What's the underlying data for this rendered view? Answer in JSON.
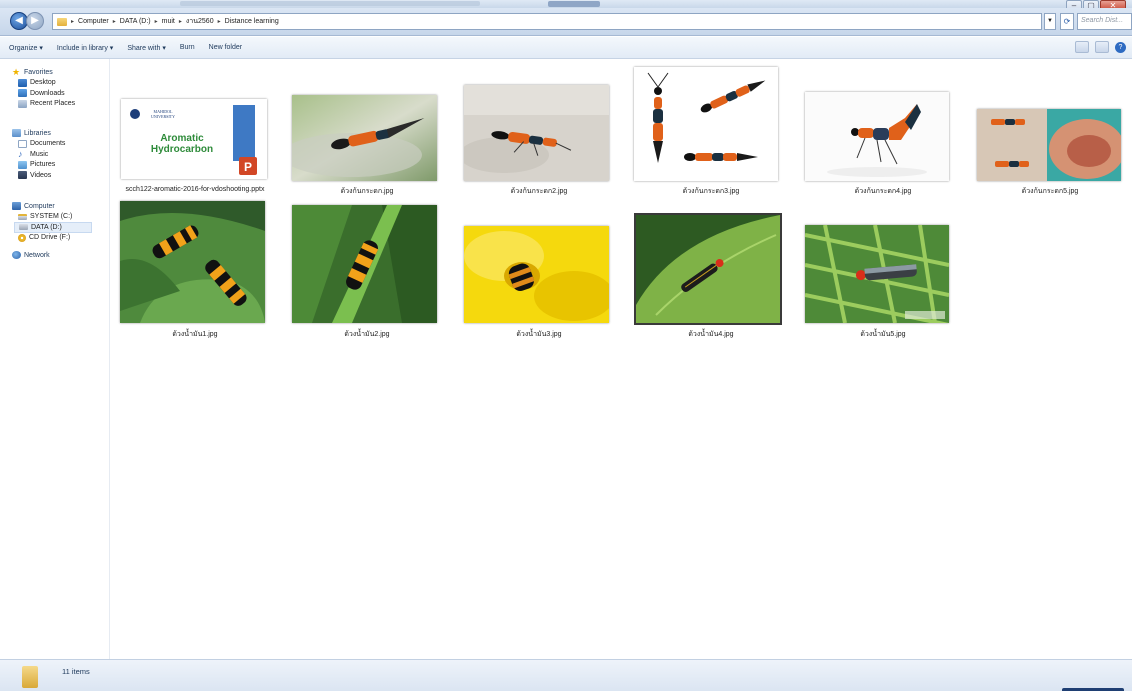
{
  "window": {
    "controls": {
      "minimize": "–",
      "maximize": "▢",
      "close": "✕"
    }
  },
  "address": {
    "crumbs": [
      "Computer",
      "DATA (D:)",
      "muit",
      "งาน2560",
      "Distance learning"
    ],
    "search_placeholder": "Search Dist..."
  },
  "toolbar": {
    "organize": "Organize ▾",
    "include_in_library": "Include in library ▾",
    "share_with": "Share with ▾",
    "burn": "Burn",
    "new_folder": "New folder"
  },
  "sidebar": {
    "favorites": {
      "label": "Favorites",
      "items": [
        "Desktop",
        "Downloads",
        "Recent Places"
      ]
    },
    "libraries": {
      "label": "Libraries",
      "items": [
        "Documents",
        "Music",
        "Pictures",
        "Videos"
      ]
    },
    "computer": {
      "label": "Computer",
      "items": [
        "SYSTEM (C:)",
        "DATA (D:)",
        "CD Drive (F:)"
      ]
    },
    "network": {
      "label": "Network"
    }
  },
  "files": [
    {
      "name": "scch122-aromatic-2016-for-vdoshooting.pptx",
      "thumb_title": "Aromatic\nHydrocarbon",
      "thumb_logo": "MAHIDOL UNIVERSITY"
    },
    {
      "name": "ด้วงก้นกระดก.jpg"
    },
    {
      "name": "ด้วงก้นกระดก2.jpg"
    },
    {
      "name": "ด้วงก้นกระดก3.jpg"
    },
    {
      "name": "ด้วงก้นกระดก4.jpg"
    },
    {
      "name": "ด้วงก้นกระดก5.jpg"
    },
    {
      "name": "ด้วงน้ำมัน1.jpg"
    },
    {
      "name": "ด้วงน้ำมัน2.jpg"
    },
    {
      "name": "ด้วงน้ำมัน3.jpg"
    },
    {
      "name": "ด้วงน้ำมัน4.jpg"
    },
    {
      "name": "ด้วงน้ำมัน5.jpg"
    }
  ],
  "status": {
    "count": "11 items"
  },
  "colors": {
    "titlebar": "#c9d8ea",
    "toolbar_text": "#1e395b",
    "selection": "#e5eef9",
    "ppt_orange": "#d24726",
    "ppt_blue": "#3e79c4",
    "beetle_orange": "#e0611a"
  }
}
